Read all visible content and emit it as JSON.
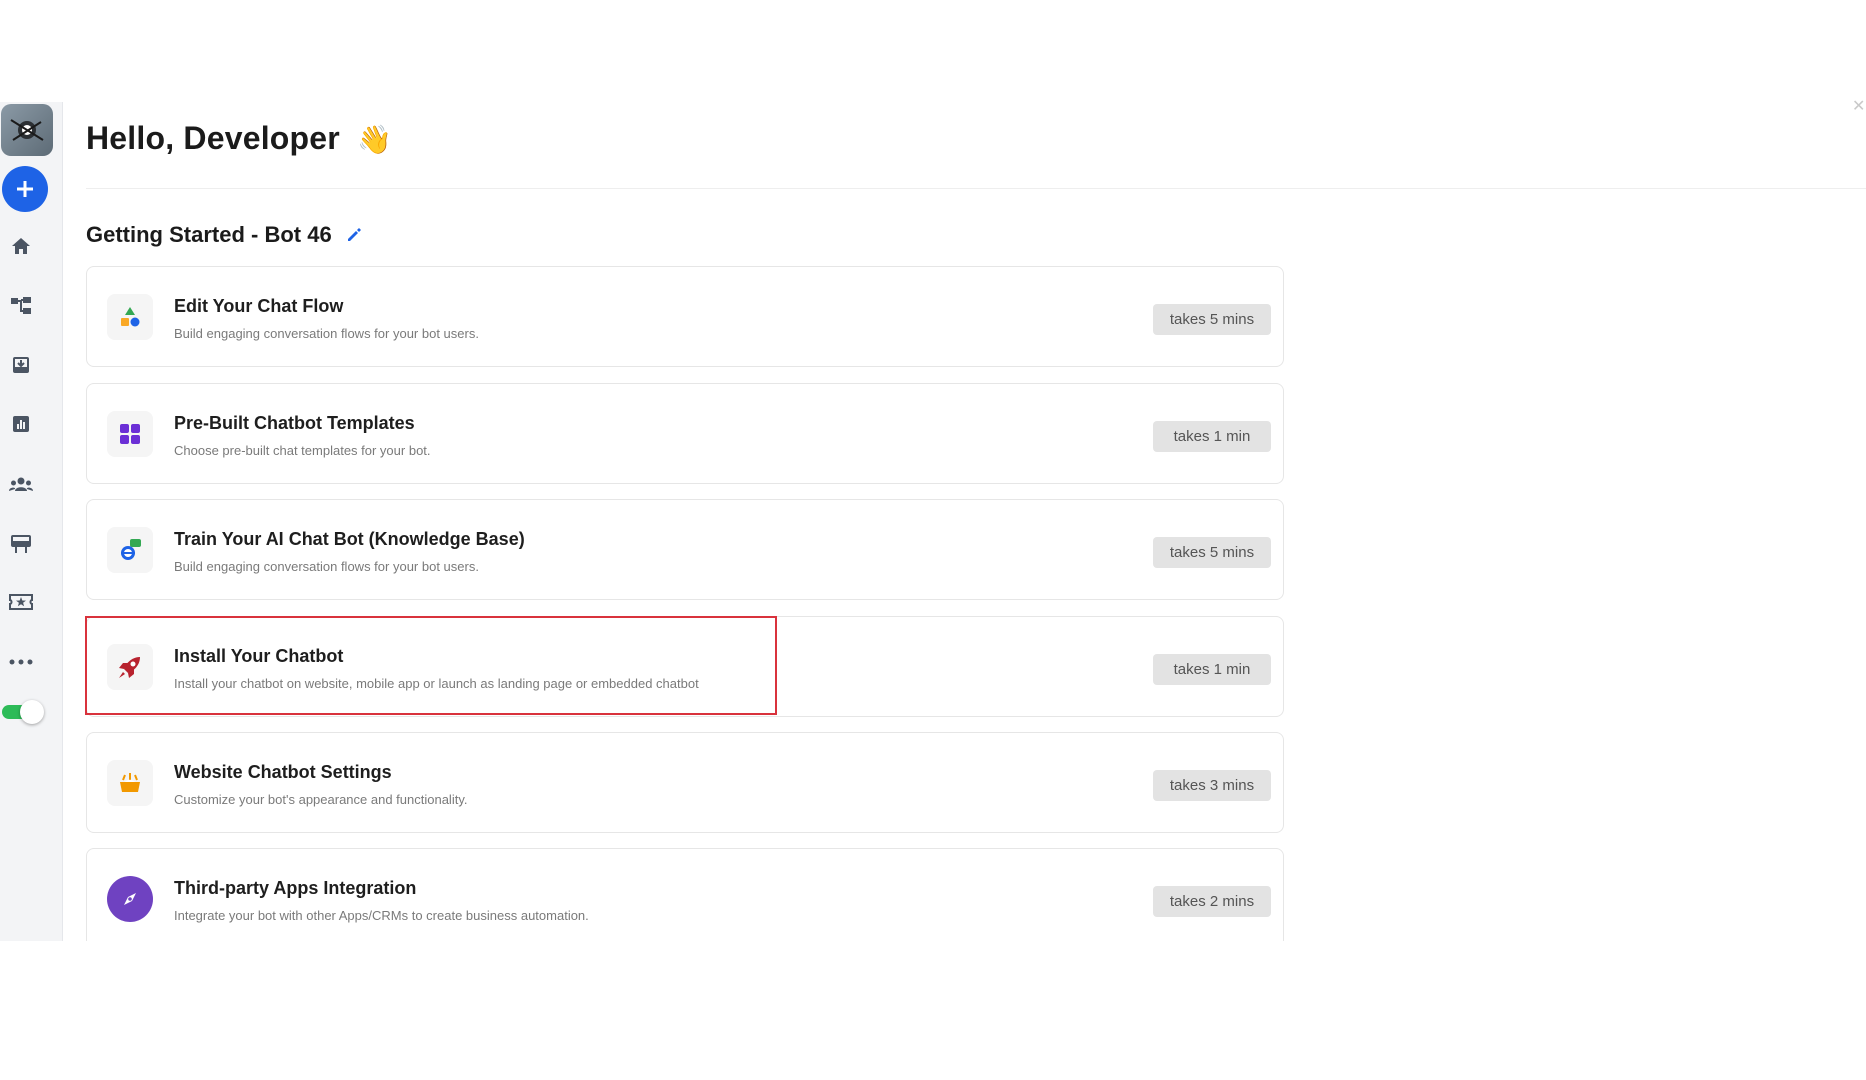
{
  "header": {
    "greeting": "Hello, Developer",
    "wave_emoji": "👋"
  },
  "section": {
    "title": "Getting Started - Bot 46"
  },
  "sidebar": {
    "items": [
      {
        "icon": "home-icon"
      },
      {
        "icon": "flow-icon"
      },
      {
        "icon": "inbox-icon"
      },
      {
        "icon": "analytics-icon"
      },
      {
        "icon": "users-icon"
      },
      {
        "icon": "billboard-icon"
      },
      {
        "icon": "ticket-icon"
      },
      {
        "icon": "more-icon"
      }
    ]
  },
  "cards": [
    {
      "title": "Edit Your Chat Flow",
      "description": "Build engaging conversation flows for your bot users.",
      "time": "takes 5 mins",
      "icon": "shapes-icon"
    },
    {
      "title": "Pre-Built Chatbot Templates",
      "description": "Choose pre-built chat templates for your bot.",
      "time": "takes 1 min",
      "icon": "grid-icon"
    },
    {
      "title": "Train Your AI Chat Bot (Knowledge Base)",
      "description": "Build engaging conversation flows for your bot users.",
      "time": "takes 5 mins",
      "icon": "knowledge-icon"
    },
    {
      "title": "Install Your Chatbot",
      "description": "Install your chatbot on website, mobile app or launch as landing page or embedded chatbot",
      "time": "takes 1 min",
      "icon": "rocket-icon"
    },
    {
      "title": "Website Chatbot Settings",
      "description": "Customize your bot's appearance and functionality.",
      "time": "takes 3 mins",
      "icon": "settings-icon"
    },
    {
      "title": "Third-party Apps Integration",
      "description": "Integrate your bot with other Apps/CRMs to create business automation.",
      "time": "takes 2 mins",
      "icon": "compass-icon"
    }
  ],
  "colors": {
    "accent": "#1e63e6",
    "highlight": "#d9323c",
    "toggle_on": "#2dbb58"
  }
}
